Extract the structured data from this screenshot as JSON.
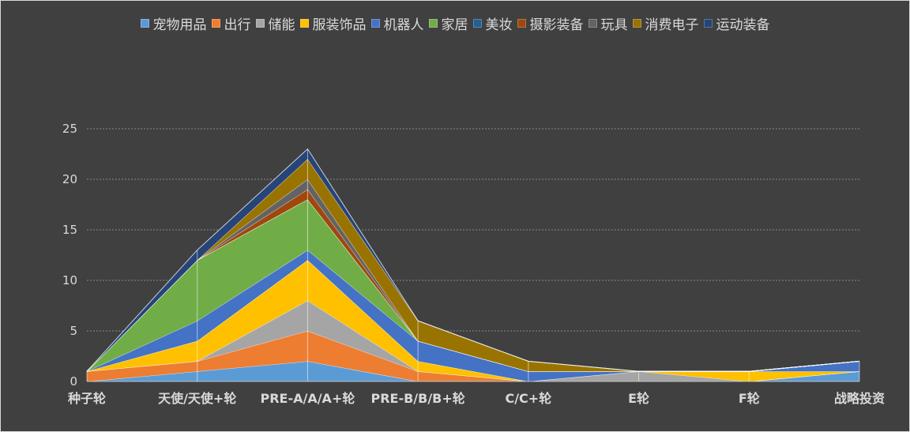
{
  "chart_data": {
    "type": "area",
    "stacked": true,
    "categories": [
      "种子轮",
      "天使/天使+轮",
      "PRE-A/A/A+轮",
      "PRE-B/B/B+轮",
      "C/C+轮",
      "E轮",
      "F轮",
      "战略投资"
    ],
    "ylim": [
      0,
      25
    ],
    "yticks": [
      0,
      5,
      10,
      15,
      20,
      25
    ],
    "grid": true,
    "legend_position": "top",
    "series": [
      {
        "name": "宠物用品",
        "color": "#5b9bd5",
        "values": [
          0,
          1,
          2,
          0,
          0,
          0,
          0,
          1
        ]
      },
      {
        "name": "出行",
        "color": "#ed7d31",
        "values": [
          1,
          1,
          3,
          1,
          0,
          0,
          0,
          0
        ]
      },
      {
        "name": "储能",
        "color": "#a5a5a5",
        "values": [
          0,
          0,
          3,
          0,
          0,
          1,
          0,
          0
        ]
      },
      {
        "name": "服装饰品",
        "color": "#ffc000",
        "values": [
          0,
          2,
          4,
          1,
          0,
          0,
          1,
          0
        ]
      },
      {
        "name": "机器人",
        "color": "#4472c4",
        "values": [
          0,
          2,
          1,
          2,
          1,
          0,
          0,
          1
        ]
      },
      {
        "name": "家居",
        "color": "#70ad47",
        "values": [
          0,
          6,
          5,
          0,
          0,
          0,
          0,
          0
        ]
      },
      {
        "name": "美妆",
        "color": "#255e91",
        "values": [
          0,
          0,
          0,
          0,
          0,
          0,
          0,
          0
        ]
      },
      {
        "name": "摄影装备",
        "color": "#9e480e",
        "values": [
          0,
          0,
          1,
          0,
          0,
          0,
          0,
          0
        ]
      },
      {
        "name": "玩具",
        "color": "#636363",
        "values": [
          0,
          0,
          1,
          0,
          0,
          0,
          0,
          0
        ]
      },
      {
        "name": "消费电子",
        "color": "#997300",
        "values": [
          0,
          0,
          2,
          2,
          1,
          0,
          0,
          0
        ]
      },
      {
        "name": "运动装备",
        "color": "#264478",
        "values": [
          0,
          1,
          1,
          0,
          0,
          0,
          0,
          0
        ]
      }
    ]
  }
}
